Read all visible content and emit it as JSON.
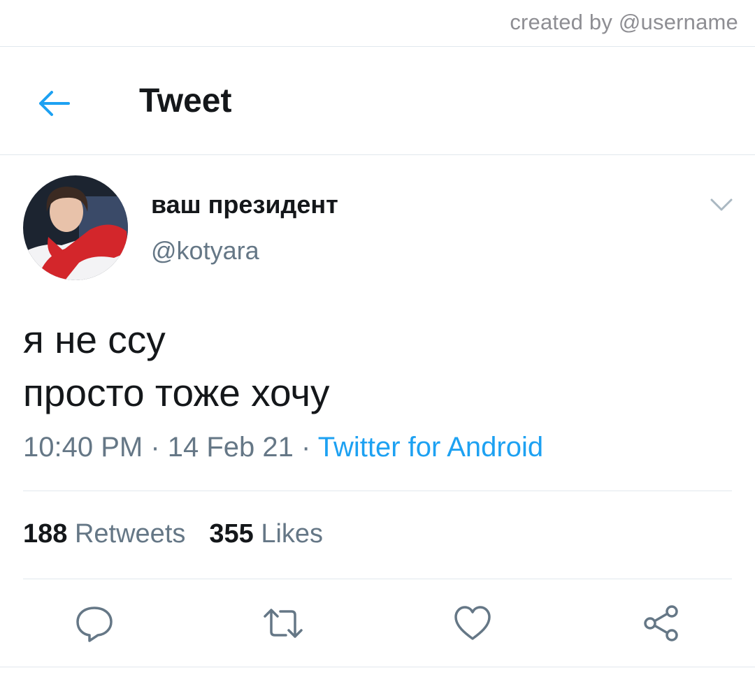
{
  "watermark": "created by @username",
  "header": {
    "title": "Tweet",
    "back_icon": "arrow-left-icon"
  },
  "author": {
    "display_name": "ваш президент",
    "handle": "@kotyara"
  },
  "tweet": {
    "lines": [
      "я не ссу",
      "просто тоже хочу"
    ],
    "time": "10:40 PM",
    "sep1": " · ",
    "date": "14 Feb 21",
    "sep2": " · ",
    "source": "Twitter for Android"
  },
  "stats": {
    "retweets_count": "188",
    "retweets_label": "Retweets",
    "likes_count": "355",
    "likes_label": "Likes"
  },
  "actions": [
    "reply-icon",
    "retweet-icon",
    "like-icon",
    "share-icon"
  ],
  "colors": {
    "accent": "#1da1f2",
    "secondary_text": "#657786",
    "divider": "#e1e8ed",
    "primary_text": "#14171a"
  }
}
